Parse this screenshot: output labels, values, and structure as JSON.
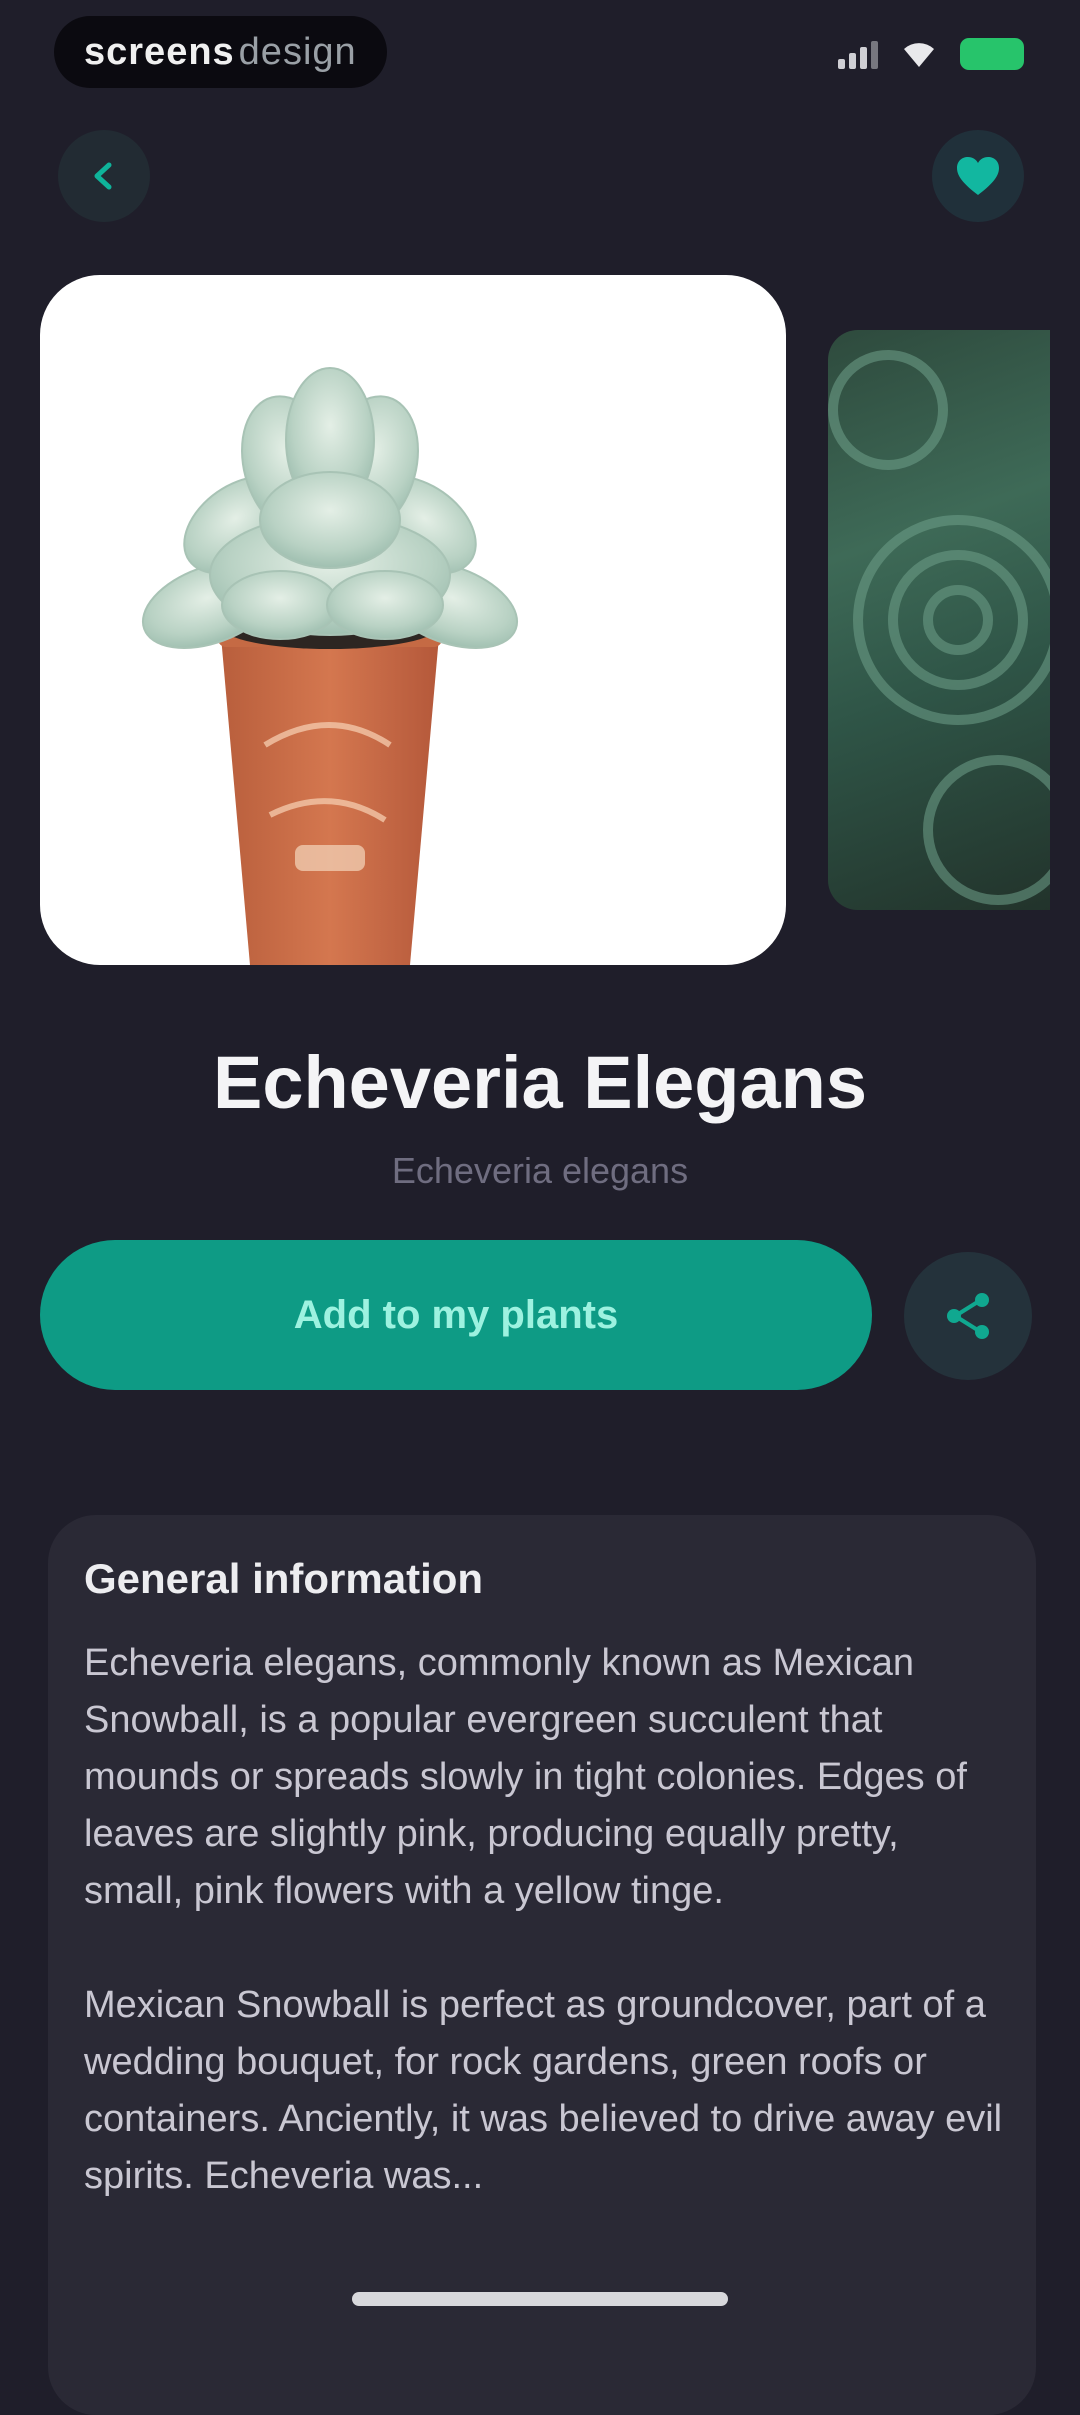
{
  "status_bar": {
    "watermark_bold": "screens",
    "watermark_light": "design"
  },
  "icons": {
    "back": "arrow-left-icon",
    "favorite": "heart-icon",
    "share": "share-icon"
  },
  "plant": {
    "name": "Echeveria Elegans",
    "latin": "Echeveria elegans"
  },
  "actions": {
    "add_label": "Add to my plants"
  },
  "general_info": {
    "title": "General information",
    "paragraphs": [
      "Echeveria elegans, commonly known as Mexican Snowball, is a popular evergreen succulent that mounds or spreads slowly in tight colonies. Edges of leaves are slightly pink, producing equally pretty, small, pink flowers with a yellow tinge.",
      "Mexican Snowball is perfect as groundcover, part of a wedding bouquet, for rock gardens, green roofs or containers. Anciently, it was believed to drive away evil spirits. Echeveria was..."
    ]
  },
  "colors": {
    "background": "#1f1e2a",
    "accent": "#0e9b85",
    "card": "#2a2935"
  }
}
